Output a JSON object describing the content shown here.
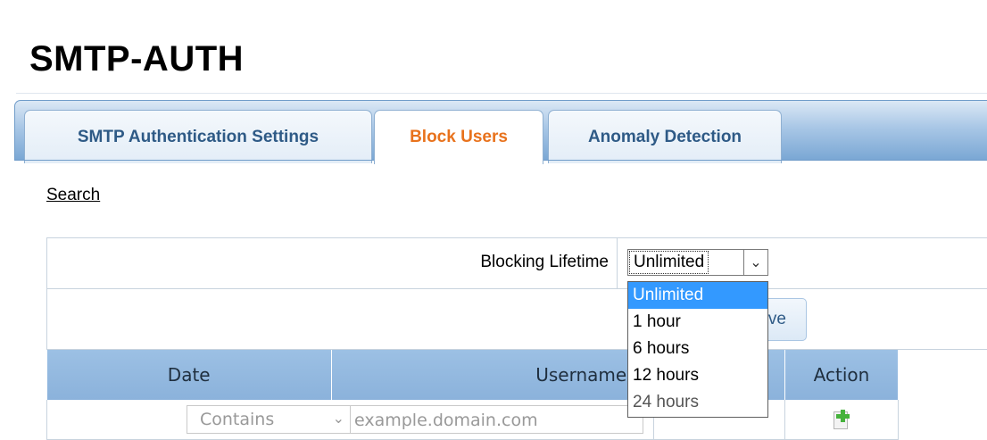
{
  "page": {
    "title": "SMTP-AUTH"
  },
  "tabs": [
    {
      "label": "SMTP Authentication Settings",
      "active": false
    },
    {
      "label": "Block Users",
      "active": true
    },
    {
      "label": "Anomaly Detection",
      "active": false
    }
  ],
  "search": {
    "label": "Search"
  },
  "form": {
    "blocking_lifetime_label": "Blocking Lifetime",
    "blocking_lifetime_value": "Unlimited",
    "save_label": "Save"
  },
  "dropdown": {
    "options": [
      "Unlimited",
      "1 hour",
      "6 hours",
      "12 hours",
      "24 hours"
    ],
    "highlighted": "Unlimited"
  },
  "table": {
    "headers": {
      "date": "Date",
      "username": "Username",
      "action": "Action"
    },
    "filter": {
      "operator": "Contains",
      "placeholder": "example.domain.com"
    }
  },
  "colors": {
    "accent": "#e8721c",
    "header": "#9cc0e4",
    "highlight": "#3399ff",
    "tab_text": "#2e5a86"
  },
  "icons": {
    "add": "add-row-icon",
    "dropdown": "chevron-down-icon"
  }
}
